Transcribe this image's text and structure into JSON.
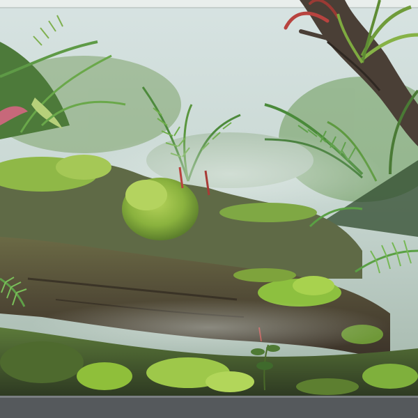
{
  "scene": {
    "subject": "misty-terrarium",
    "palette": {
      "fog_sky": "#dfe8e5",
      "fog_mid": "#b9c9c2",
      "moss_bright": "#8fbf3a",
      "moss_dark": "#4f6e2a",
      "fern": "#4a8a3a",
      "fern_light": "#7fb04f",
      "wood": "#5a4a3a",
      "wood_dark": "#3a3028",
      "glass_frame": "#55595c",
      "bromeliad_red": "#b8433f"
    }
  }
}
